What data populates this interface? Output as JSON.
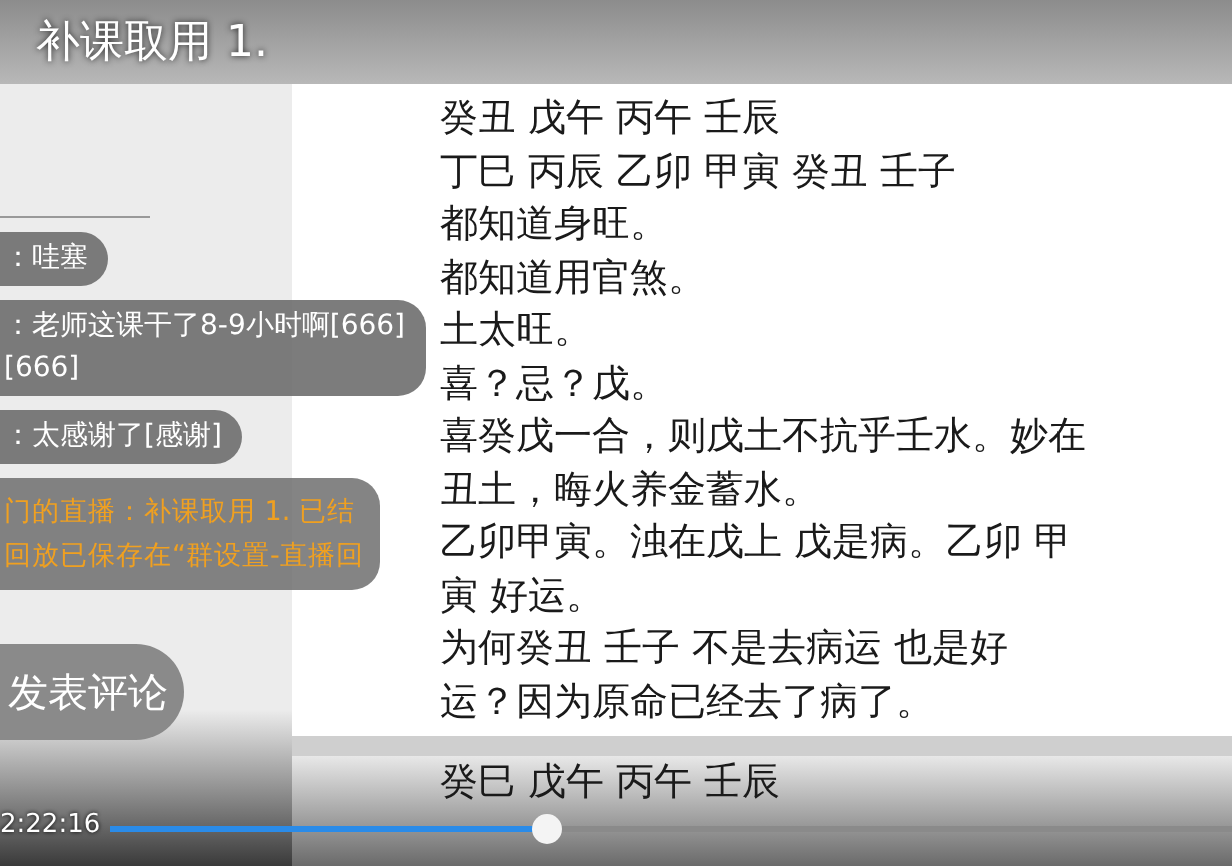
{
  "title": "补课取用 1.",
  "document": {
    "lines": [
      "癸丑 戊午 丙午 壬辰",
      "丁巳 丙辰 乙卯 甲寅 癸丑 壬子",
      "都知道身旺。",
      "都知道用官煞。",
      "土太旺。",
      "喜？忌？戊。",
      "喜癸戊一合，则戊土不抗乎壬水。妙在",
      "丑土，晦火养金蓄水。",
      "乙卯甲寅。浊在戊上 戊是病。乙卯 甲",
      "寅 好运。",
      "为何癸丑 壬子 不是去病运 也是好",
      "运？因为原命已经去了病了。"
    ],
    "next_page_lines": [
      "癸巳 戊午 丙午 壬辰"
    ]
  },
  "chat": {
    "messages": [
      {
        "kind": "comment",
        "lines": [
          "：哇塞"
        ]
      },
      {
        "kind": "comment",
        "lines": [
          "：老师这课干了8-9小时啊[666]",
          "[666]"
        ]
      },
      {
        "kind": "comment",
        "lines": [
          "：太感谢了[感谢]"
        ]
      },
      {
        "kind": "system",
        "lines": [
          "门的直播：补课取用 1. 已结",
          "回放已保存在“群设置-直播回"
        ]
      }
    ],
    "comment_button": "发表评论"
  },
  "player": {
    "time": "2:22:16",
    "progress": {
      "level": 0.39
    }
  }
}
